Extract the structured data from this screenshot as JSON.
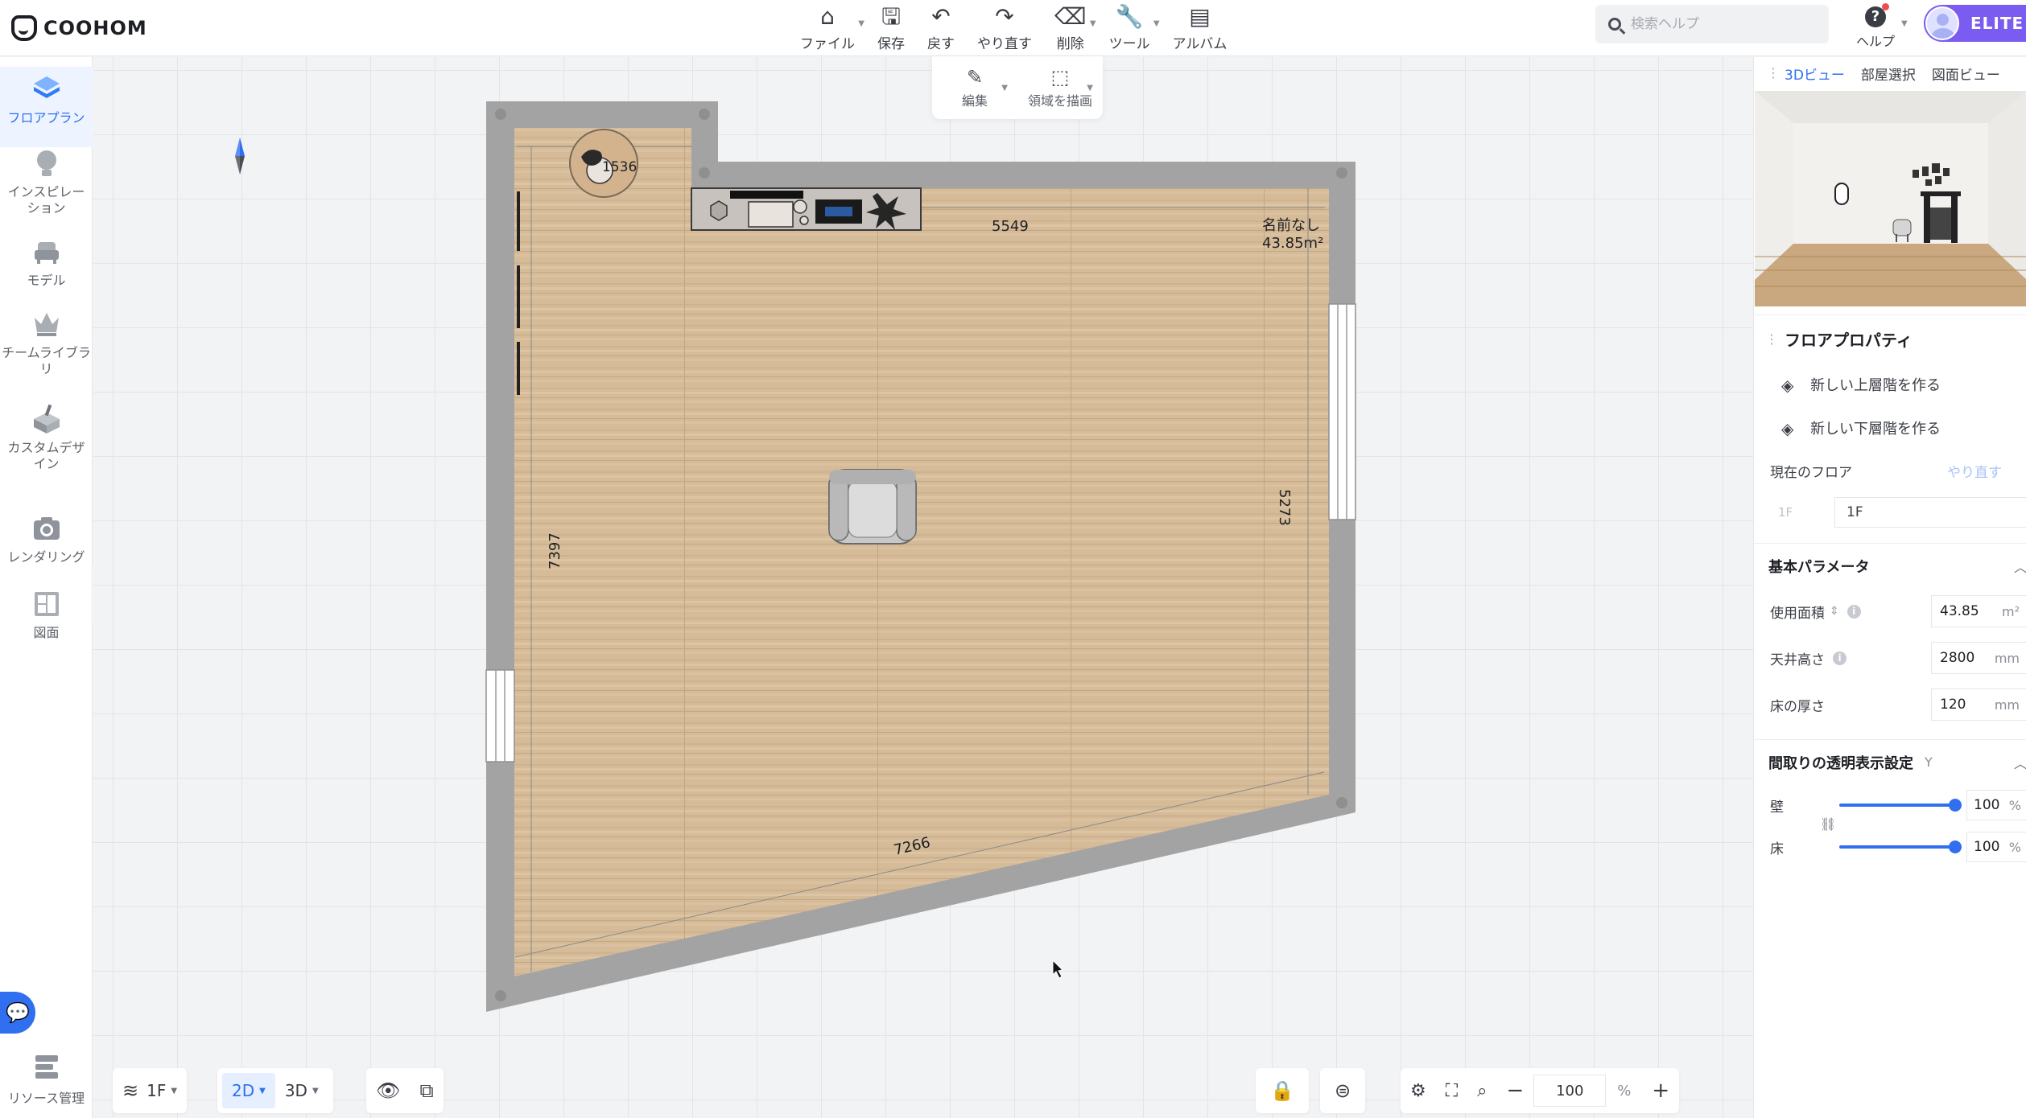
{
  "app": {
    "logo_text": "COOHOM"
  },
  "toolbar": {
    "items": [
      {
        "label": "ファイル",
        "icon": "home-icon"
      },
      {
        "label": "保存",
        "icon": "save-icon"
      },
      {
        "label": "戻す",
        "icon": "undo-icon"
      },
      {
        "label": "やり直す",
        "icon": "redo-icon"
      },
      {
        "label": "削除",
        "icon": "eraser-icon"
      },
      {
        "label": "ツール",
        "icon": "wrench-icon"
      },
      {
        "label": "アルバム",
        "icon": "album-icon"
      }
    ]
  },
  "subtools": {
    "edit_label": "編集",
    "draw_area_label": "領域を描画"
  },
  "search": {
    "placeholder": "検索ヘルプ"
  },
  "help": {
    "label": "ヘルプ"
  },
  "user": {
    "badge": "ELITE"
  },
  "sidebar": {
    "items": [
      {
        "label": "フロアプラン",
        "icon": "floorplan-icon",
        "active": true
      },
      {
        "label": "インスピレーション",
        "icon": "bulb-icon"
      },
      {
        "label": "モデル",
        "icon": "sofa-icon"
      },
      {
        "label": "チームライブラリ",
        "icon": "crown-icon"
      },
      {
        "label": "カスタムデザイン",
        "icon": "custom-design-icon"
      },
      {
        "label": "レンダリング",
        "icon": "camera-icon"
      },
      {
        "label": "図面",
        "icon": "drawing-icon"
      }
    ],
    "resource_label": "リソース管理"
  },
  "floorplan": {
    "room_name": "名前なし",
    "room_area": "43.85m²",
    "dim_top": "5549",
    "dim_right": "5273",
    "dim_left": "7397",
    "dim_bottom": "7266",
    "dim_small": "1536"
  },
  "bottom_left": {
    "floor": "1F",
    "view_2d": "2D",
    "view_3d": "3D"
  },
  "bottom_right": {
    "zoom_value": "100",
    "zoom_unit": "%"
  },
  "right_panel": {
    "tabs": [
      "3Dビュー",
      "部屋選択",
      "図面ビュー"
    ],
    "props_title": "フロアプロパティ",
    "new_upper": "新しい上層階を作る",
    "new_lower": "新しい下層階を作る",
    "current_floor_label": "現在のフロア",
    "redo_link": "やり直す",
    "floor_prefix": "1F",
    "floor_value": "1F",
    "basic_params_title": "基本パラメータ",
    "area_label": "使用面積",
    "area_value": "43.85",
    "area_unit": "m²",
    "ceiling_label": "天井高さ",
    "ceiling_value": "2800",
    "ceiling_unit": "mm",
    "floor_thick_label": "床の厚さ",
    "floor_thick_value": "120",
    "floor_thick_unit": "mm",
    "transparency_title": "間取りの透明表示設定",
    "transparency_hint": "Y",
    "wall_label": "壁",
    "wall_value": "100",
    "floor_label": "床",
    "floor_trans_value": "100",
    "pct_unit": "%"
  },
  "colors": {
    "accent": "#2f6ff0",
    "elite": "#7b5cf0",
    "wall": "#a3a3a3",
    "wood": "#d4b996"
  }
}
